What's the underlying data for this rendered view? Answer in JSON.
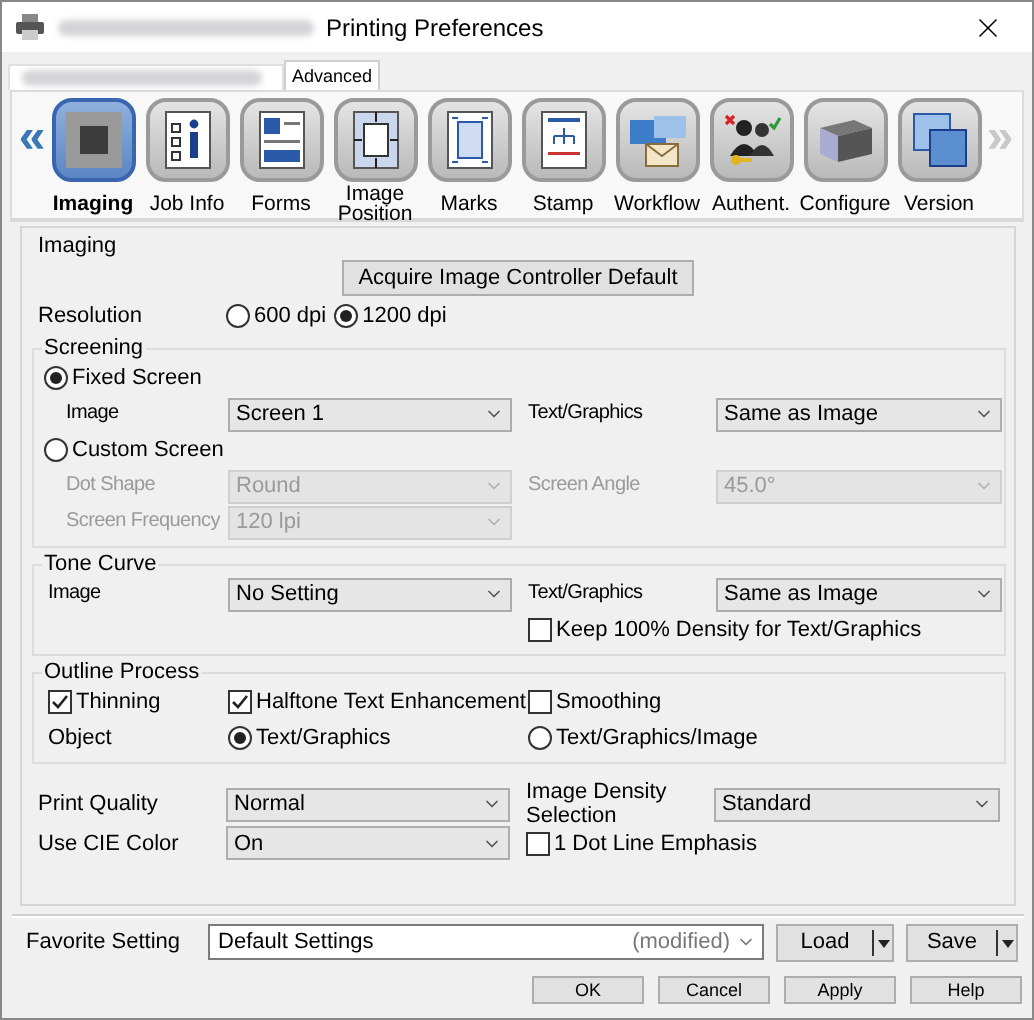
{
  "window": {
    "title": "Printing Preferences"
  },
  "tabs": [
    {
      "label": "Advanced",
      "selected": true
    }
  ],
  "nav": {
    "prev": {
      "label": "«",
      "disabled": false
    },
    "next": {
      "label": "»",
      "disabled": true
    }
  },
  "categories": [
    {
      "label": "Imaging",
      "kind": "imaging",
      "selected": true
    },
    {
      "label": "Job Info",
      "kind": "info",
      "selected": false
    },
    {
      "label": "Forms",
      "kind": "forms",
      "selected": false
    },
    {
      "label": "Image Position",
      "kind": "position",
      "selected": false
    },
    {
      "label": "Marks",
      "kind": "marks",
      "selected": false
    },
    {
      "label": "Stamp",
      "kind": "stamp",
      "selected": false
    },
    {
      "label": "Workflow",
      "kind": "workflow",
      "selected": false
    },
    {
      "label": "Authent.",
      "kind": "auth",
      "selected": false
    },
    {
      "label": "Configure",
      "kind": "configure",
      "selected": false
    },
    {
      "label": "Version",
      "kind": "version",
      "selected": false
    }
  ],
  "imaging": {
    "title": "Imaging",
    "acquire": "Acquire Image Controller Default",
    "resolution": {
      "label": "Resolution",
      "options": [
        {
          "label": "600 dpi",
          "selected": false
        },
        {
          "label": "1200 dpi",
          "selected": true
        }
      ]
    }
  },
  "screening": {
    "title": "Screening",
    "modes": [
      {
        "label": "Fixed Screen",
        "selected": true,
        "rows": [
          [
            {
              "label": "Image",
              "value": "Screen 1",
              "disabled": false
            },
            {
              "label": "Text/Graphics",
              "value": "Same as Image",
              "disabled": false
            }
          ]
        ]
      },
      {
        "label": "Custom Screen",
        "selected": false,
        "rows": [
          [
            {
              "label": "Dot Shape",
              "value": "Round",
              "disabled": true
            },
            {
              "label": "Screen Angle",
              "value": "45.0°",
              "disabled": true
            }
          ],
          [
            {
              "label": "Screen Frequency",
              "value": "120 lpi",
              "disabled": true
            }
          ]
        ]
      }
    ]
  },
  "tone_curve": {
    "title": "Tone Curve",
    "fields": [
      {
        "label": "Image",
        "value": "No Setting"
      },
      {
        "label": "Text/Graphics",
        "value": "Same as Image"
      }
    ],
    "checkbox": {
      "label": "Keep 100% Density for Text/Graphics",
      "checked": false
    }
  },
  "outline": {
    "title": "Outline Process",
    "checkboxes": [
      {
        "label": "Thinning",
        "checked": true
      },
      {
        "label": "Halftone Text Enhancement",
        "checked": true
      },
      {
        "label": "Smoothing",
        "checked": false
      }
    ],
    "object": {
      "label": "Object",
      "options": [
        {
          "label": "Text/Graphics",
          "selected": true
        },
        {
          "label": "Text/Graphics/Image",
          "selected": false
        }
      ]
    }
  },
  "quality": [
    {
      "fields": [
        {
          "label": "Print Quality",
          "value": "Normal"
        },
        {
          "label": "Image Density Selection",
          "value": "Standard"
        }
      ]
    },
    {
      "fields": [
        {
          "label": "Use CIE Color",
          "value": "On"
        }
      ],
      "checkbox": {
        "label": "1 Dot Line Emphasis",
        "checked": false
      }
    }
  ],
  "favorite": {
    "label": "Favorite Setting",
    "value": "Default Settings",
    "suffix": "(modified)",
    "buttons": [
      "Load",
      "Save"
    ]
  },
  "buttons": [
    "OK",
    "Cancel",
    "Apply",
    "Help"
  ]
}
